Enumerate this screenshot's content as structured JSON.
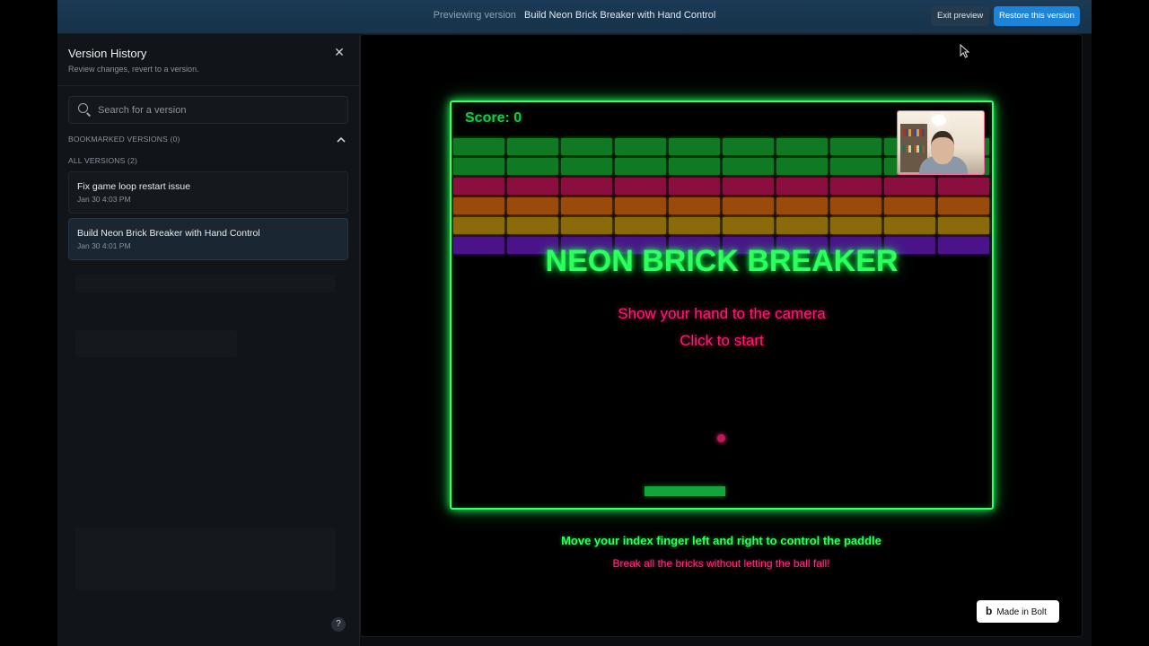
{
  "topbar": {
    "prefix": "Previewing version",
    "version_name": "Build Neon Brick Breaker with Hand Control",
    "exit_label": "Exit preview",
    "restore_label": "Restore this version"
  },
  "sidebar": {
    "title": "Version History",
    "subtitle": "Review changes, revert to a version.",
    "search_placeholder": "Search for a version",
    "bookmarked_header": "BOOKMARKED VERSIONS (0)",
    "all_header": "ALL VERSIONS (2)",
    "versions": [
      {
        "title": "Fix game loop restart issue",
        "date": "Jan 30 4:03 PM"
      },
      {
        "title": "Build Neon Brick Breaker with Hand Control",
        "date": "Jan 30 4:01 PM"
      }
    ]
  },
  "game": {
    "score": "Score: 0",
    "title": "NEON BRICK BREAKER",
    "hand_message": "Show your hand to the camera",
    "click_message": "Click to start",
    "brick_row_colors": [
      "#0f7a22",
      "#0f7a22",
      "#8a0f3e",
      "#9a4a0a",
      "#8a6a0a",
      "#4a138a"
    ],
    "brick_columns": 10
  },
  "instructions": {
    "line1": "Move your index finger left and right to control the paddle",
    "line2": "Break all the bricks without letting the ball fall!"
  },
  "badge": {
    "label": "Made in Bolt"
  }
}
